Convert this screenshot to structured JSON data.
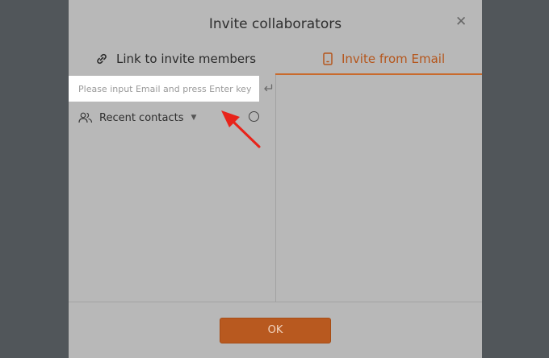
{
  "dialog": {
    "title": "Invite collaborators",
    "close_icon": "close-icon"
  },
  "tabs": [
    {
      "label": "Link to invite members",
      "icon": "link-icon",
      "active": false
    },
    {
      "label": "Invite from Email",
      "icon": "phone-icon",
      "active": true
    }
  ],
  "email": {
    "placeholder": "Please input Email and press Enter key",
    "value": "",
    "enter_icon": "enter-icon"
  },
  "recent_contacts": {
    "label": "Recent contacts",
    "icon": "contacts-icon",
    "caret_icon": "caret-down-icon"
  },
  "footer": {
    "ok_label": "OK"
  },
  "colors": {
    "accent": "#b8591f",
    "active_tab_text": "#b5561c",
    "overlay": "#51565a",
    "dialog_bg": "#b8b8b8",
    "annotation_arrow": "#e8231a"
  }
}
